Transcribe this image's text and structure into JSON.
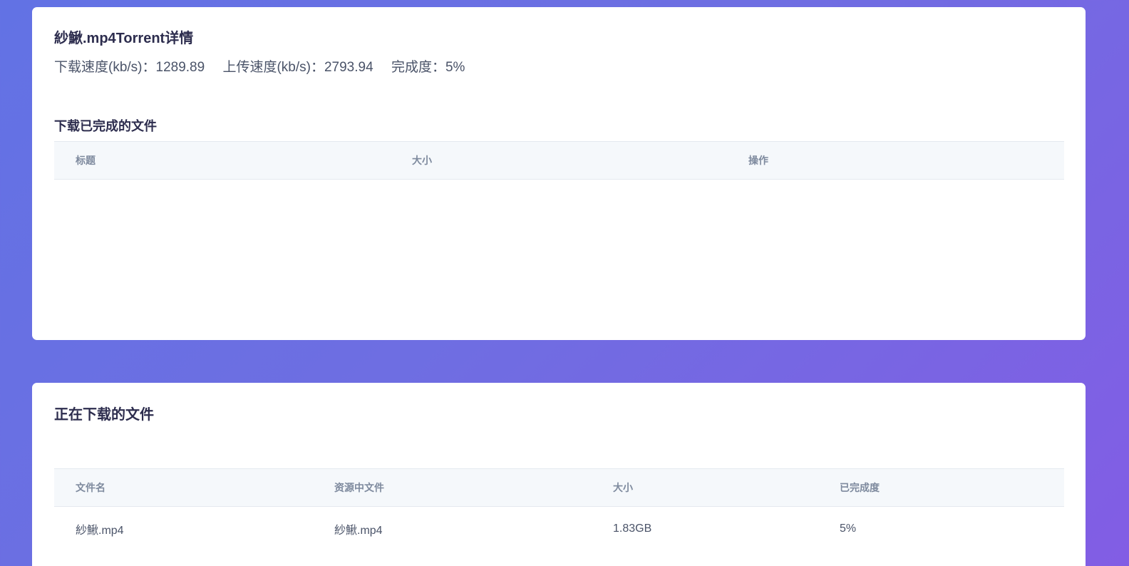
{
  "torrent": {
    "title": "紗鰍.mp4Torrent详情",
    "download_speed": "下载速度(kb/s)：1289.89",
    "upload_speed": "上传速度(kb/s)：2793.94",
    "progress": "完成度：5%"
  },
  "completed": {
    "title": "下载已完成的文件",
    "columns": [
      "标题",
      "大小",
      "操作"
    ],
    "rows": []
  },
  "downloading": {
    "title": "正在下载的文件",
    "columns": [
      "文件名",
      "资源中文件",
      "大小",
      "已完成度"
    ],
    "rows": [
      [
        "紗鰍.mp4",
        "紗鰍.mp4",
        "1.83GB",
        "5%"
      ]
    ]
  }
}
